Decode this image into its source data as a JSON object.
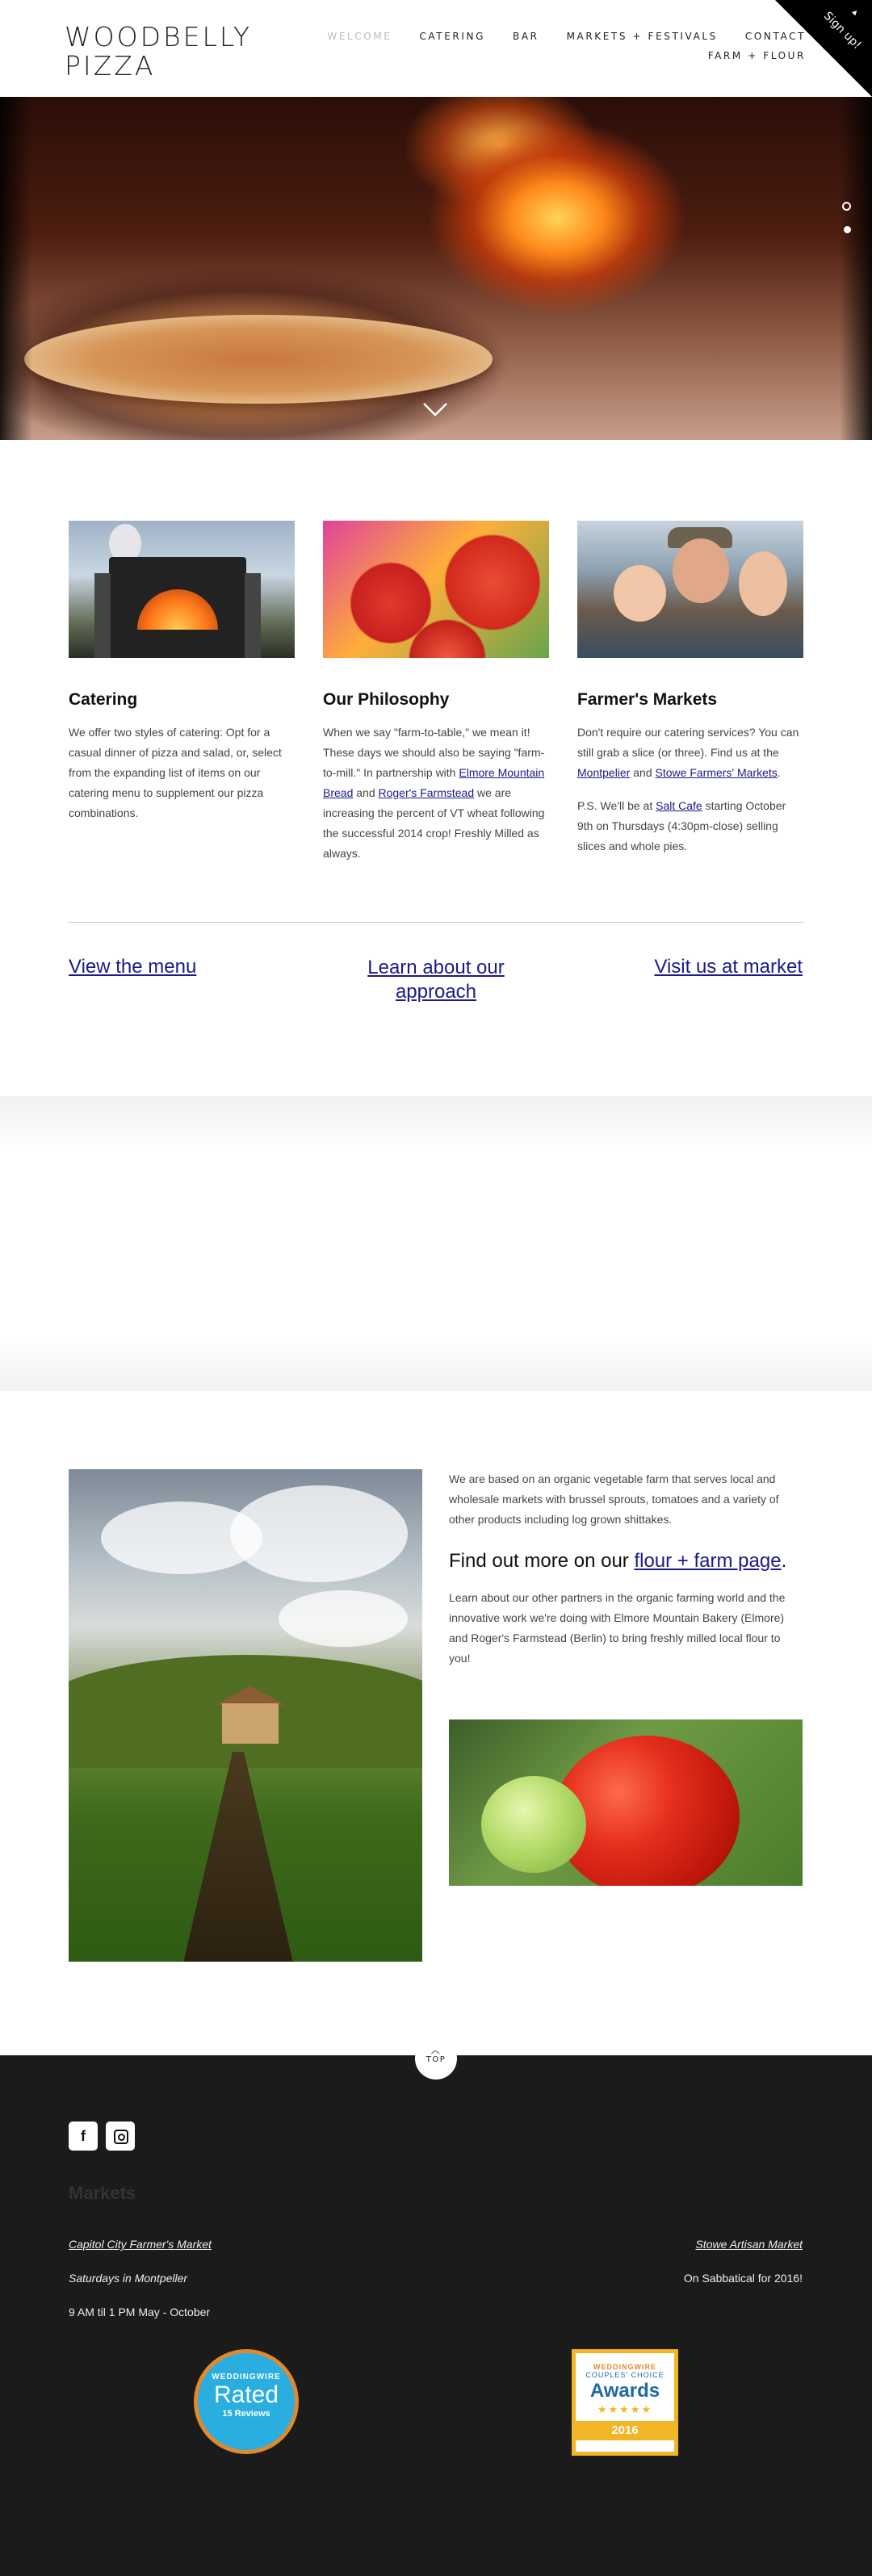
{
  "header": {
    "logo_line1": "WOODBELLY",
    "logo_line2": "PIZZA",
    "nav": [
      "WELCOME",
      "CATERING",
      "BAR",
      "MARKETS + FESTIVALS",
      "CONTACT",
      "FARM + FLOUR"
    ],
    "signup_label": "Sign up!"
  },
  "features": {
    "catering": {
      "title": "Catering",
      "text": "We offer two styles of catering: Opt for a casual dinner of pizza and salad, or, select from the expanding list of items on our catering menu to supplement our pizza combinations."
    },
    "philosophy": {
      "title": "Our Philosophy",
      "text_before": "When we say \"farm-to-table,\" we mean it! These days we should also be saying \"farm-to-mill.\" In partnership with ",
      "link1": "Elmore Mountain Bread",
      "text_mid": " and ",
      "link2": "Roger's Farmstead",
      "text_after": " we are increasing the percent of VT wheat following the successful 2014 crop! Freshly Milled as always."
    },
    "markets": {
      "title": "Farmer's Markets",
      "p1_before": "Don't require our catering services? You can still grab a slice (or three). Find us at the ",
      "p1_link1": "Montpelier",
      "p1_mid": " and ",
      "p1_link2": "Stowe Farmers' Markets",
      "p1_after": ".",
      "p2_before": "P.S. We'll be at ",
      "p2_link": "Salt Cafe",
      "p2_after": " starting October 9th on Thursdays (4:30pm-close) selling slices and whole pies."
    }
  },
  "cta": {
    "menu": "View the menu",
    "approach": "Learn about our approach",
    "market": "Visit us at market"
  },
  "farm": {
    "intro": "We are based on an organic vegetable farm that serves local and wholesale markets with brussel sprouts, tomatoes and a variety of other products including log grown shittakes.",
    "heading_before": "Find out more on our ",
    "heading_link": "flour + farm page",
    "heading_after": ".",
    "partners": "Learn about our other partners in the organic farming world and the innovative work we're doing with Elmore Mountain Bakery (Elmore) and Roger's Farmstead (Berlin) to bring freshly milled local flour to you!"
  },
  "footer": {
    "top_label": "TOP",
    "markets_title": "Markets",
    "market1_name": "Capitol City Farmer's Market",
    "market1_when": "Saturdays in Montpeller",
    "market1_hours": "9 AM til 1 PM May - October",
    "market2_name": "Stowe Artisan Market",
    "market2_status": "On Sabbatical for 2016!",
    "badge1": {
      "brand": "WEDDINGWIRE",
      "big": "Rated",
      "reviews": "15 Reviews"
    },
    "badge2": {
      "brand": "WEDDINGWIRE",
      "sub": "COUPLES' CHOICE",
      "big": "Awards",
      "stars": "★★★★★",
      "year": "2016"
    }
  },
  "colors": {
    "link": "#1a1a8c",
    "footer_bg": "#1b1b1b",
    "nav_active": "#bbbbbb"
  }
}
